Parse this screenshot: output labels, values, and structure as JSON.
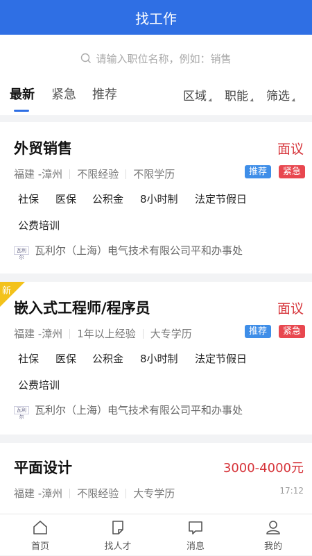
{
  "header": {
    "title": "找工作"
  },
  "search": {
    "placeholder": "请输入职位名称，例如：销售"
  },
  "tabs": [
    {
      "label": "最新",
      "active": true
    },
    {
      "label": "紧急",
      "active": false
    },
    {
      "label": "推荐",
      "active": false
    }
  ],
  "filters": [
    {
      "label": "区域"
    },
    {
      "label": "职能"
    },
    {
      "label": "筛选"
    }
  ],
  "jobs": [
    {
      "title": "外贸销售",
      "salary": "面议",
      "location": "福建 -漳州",
      "experience": "不限经验",
      "education": "不限学历",
      "badges": [
        "推荐",
        "紧急"
      ],
      "benefits": [
        "社保",
        "医保",
        "公积金",
        "8小时制",
        "法定节假日",
        "公费培训"
      ],
      "company": "瓦利尔（上海）电气技术有限公司平和办事处",
      "is_new": false
    },
    {
      "title": "嵌入式工程师/程序员",
      "salary": "面议",
      "location": "福建 -漳州",
      "experience": "1年以上经验",
      "education": "大专学历",
      "badges": [
        "推荐",
        "紧急"
      ],
      "benefits": [
        "社保",
        "医保",
        "公积金",
        "8小时制",
        "法定节假日",
        "公费培训"
      ],
      "company": "瓦利尔（上海）电气技术有限公司平和办事处",
      "is_new": true,
      "new_label": "新"
    },
    {
      "title": "平面设计",
      "salary": "3000-4000元",
      "location": "福建 -漳州",
      "experience": "不限经验",
      "education": "大专学历",
      "time": "17:12"
    }
  ],
  "bottom_nav": [
    {
      "label": "首页",
      "icon": "home-icon"
    },
    {
      "label": "找人才",
      "icon": "document-icon"
    },
    {
      "label": "消息",
      "icon": "message-icon"
    },
    {
      "label": "我的",
      "icon": "user-icon"
    }
  ],
  "colors": {
    "brand": "#2f6fe4",
    "salary": "#d6343a",
    "badge_recommend": "#3f8ee8",
    "badge_urgent": "#e8474f",
    "new_tag": "#f3c21b"
  }
}
